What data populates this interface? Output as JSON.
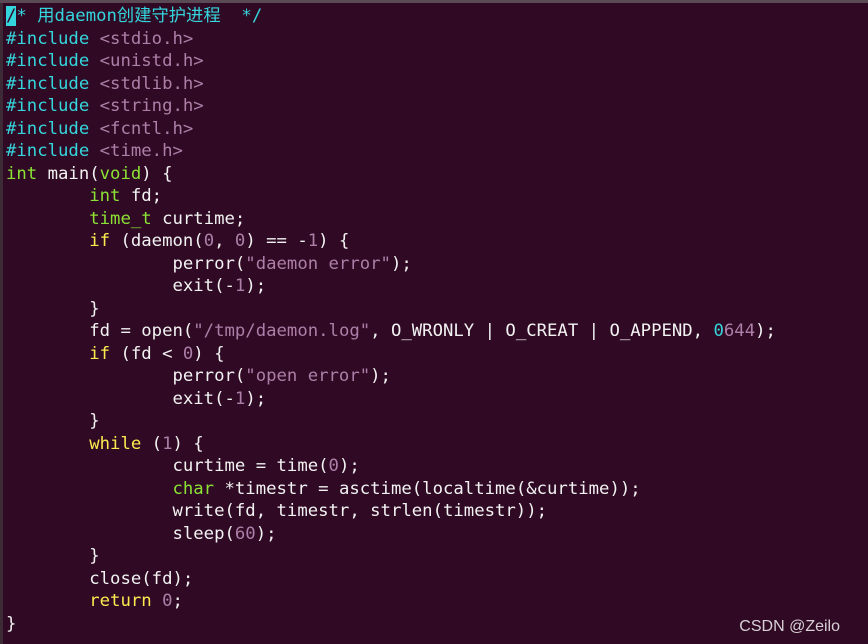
{
  "colors": {
    "background": "#300a24",
    "comment": "#34d5dc",
    "string": "#ad7fa8",
    "type": "#8ae234",
    "keyword": "#fce94f"
  },
  "editor": {
    "lines": [
      [
        [
          "cursor",
          "/"
        ],
        [
          "cm",
          "* 用daemon创建守护进程  */"
        ]
      ],
      [
        [
          "pp",
          "#include"
        ],
        [
          "n",
          " "
        ],
        [
          "st",
          "<stdio.h>"
        ]
      ],
      [
        [
          "pp",
          "#include"
        ],
        [
          "n",
          " "
        ],
        [
          "st",
          "<unistd.h>"
        ]
      ],
      [
        [
          "pp",
          "#include"
        ],
        [
          "n",
          " "
        ],
        [
          "st",
          "<stdlib.h>"
        ]
      ],
      [
        [
          "pp",
          "#include"
        ],
        [
          "n",
          " "
        ],
        [
          "st",
          "<string.h>"
        ]
      ],
      [
        [
          "pp",
          "#include"
        ],
        [
          "n",
          " "
        ],
        [
          "st",
          "<fcntl.h>"
        ]
      ],
      [
        [
          "pp",
          "#include"
        ],
        [
          "n",
          " "
        ],
        [
          "st",
          "<time.h>"
        ]
      ],
      [
        [
          "ty",
          "int"
        ],
        [
          "n",
          " main("
        ],
        [
          "ty",
          "void"
        ],
        [
          "n",
          ") {"
        ]
      ],
      [
        [
          "n",
          "        "
        ],
        [
          "ty",
          "int"
        ],
        [
          "n",
          " fd;"
        ]
      ],
      [
        [
          "n",
          "        "
        ],
        [
          "ty",
          "time_t"
        ],
        [
          "n",
          " curtime;"
        ]
      ],
      [
        [
          "n",
          "        "
        ],
        [
          "kw",
          "if"
        ],
        [
          "n",
          " (daemon("
        ],
        [
          "num",
          "0"
        ],
        [
          "n",
          ", "
        ],
        [
          "num",
          "0"
        ],
        [
          "n",
          ") == -"
        ],
        [
          "num",
          "1"
        ],
        [
          "n",
          ") {"
        ]
      ],
      [
        [
          "n",
          "                perror("
        ],
        [
          "st",
          "\"daemon error\""
        ],
        [
          "n",
          ");"
        ]
      ],
      [
        [
          "n",
          "                exit(-"
        ],
        [
          "num",
          "1"
        ],
        [
          "n",
          ");"
        ]
      ],
      [
        [
          "n",
          "        }"
        ]
      ],
      [
        [
          "n",
          "        fd = open("
        ],
        [
          "st",
          "\"/tmp/daemon.log\""
        ],
        [
          "n",
          ", O_WRONLY | O_CREAT | O_APPEND, "
        ],
        [
          "oct",
          "0"
        ],
        [
          "num",
          "644"
        ],
        [
          "n",
          ");"
        ]
      ],
      [
        [
          "n",
          "        "
        ],
        [
          "kw",
          "if"
        ],
        [
          "n",
          " (fd < "
        ],
        [
          "num",
          "0"
        ],
        [
          "n",
          ") {"
        ]
      ],
      [
        [
          "n",
          "                perror("
        ],
        [
          "st",
          "\"open error\""
        ],
        [
          "n",
          ");"
        ]
      ],
      [
        [
          "n",
          "                exit(-"
        ],
        [
          "num",
          "1"
        ],
        [
          "n",
          ");"
        ]
      ],
      [
        [
          "n",
          "        }"
        ]
      ],
      [
        [
          "n",
          "        "
        ],
        [
          "kw",
          "while"
        ],
        [
          "n",
          " ("
        ],
        [
          "num",
          "1"
        ],
        [
          "n",
          ") {"
        ]
      ],
      [
        [
          "n",
          "                curtime = time("
        ],
        [
          "num",
          "0"
        ],
        [
          "n",
          ");"
        ]
      ],
      [
        [
          "n",
          "                "
        ],
        [
          "ty",
          "char"
        ],
        [
          "n",
          " *timestr = asctime(localtime(&curtime));"
        ]
      ],
      [
        [
          "n",
          "                write(fd, timestr, strlen(timestr));"
        ]
      ],
      [
        [
          "n",
          "                sleep("
        ],
        [
          "num",
          "60"
        ],
        [
          "n",
          ");"
        ]
      ],
      [
        [
          "n",
          "        }"
        ]
      ],
      [
        [
          "n",
          "        close(fd);"
        ]
      ],
      [
        [
          "n",
          "        "
        ],
        [
          "kw",
          "return"
        ],
        [
          "n",
          " "
        ],
        [
          "num",
          "0"
        ],
        [
          "n",
          ";"
        ]
      ],
      [
        [
          "n",
          "}"
        ]
      ]
    ]
  },
  "watermark": "CSDN @Zeilo"
}
